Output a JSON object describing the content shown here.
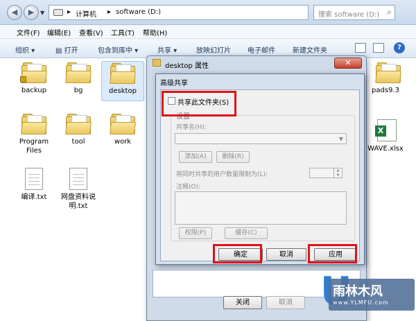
{
  "explorer": {
    "address": {
      "crumbs": [
        "计算机",
        "software (D:)"
      ]
    },
    "search_placeholder": "搜索 software (D:)",
    "menu": [
      "文件(F)",
      "编辑(E)",
      "查看(V)",
      "工具(T)",
      "帮助(H)"
    ],
    "toolbar": {
      "organize": "组织 ▾",
      "open": "打开",
      "include": "包含到库中 ▾",
      "share": "共享 ▾",
      "slideshow": "放映幻灯片",
      "email": "电子邮件",
      "new_folder": "新建文件夹"
    },
    "items": [
      {
        "label": "backup"
      },
      {
        "label": "bg"
      },
      {
        "label": "desktop"
      },
      {
        "label": "Program Files"
      },
      {
        "label": "tool"
      },
      {
        "label": "work"
      },
      {
        "label": "编译.txt"
      },
      {
        "label": "网盘资料说明.txt"
      },
      {
        "label": "pads9.3"
      },
      {
        "label": "WAVE.xlsx"
      }
    ]
  },
  "properties": {
    "title": "desktop 属性",
    "close_button": "关闭",
    "cancel_button": "取消"
  },
  "advanced_sharing": {
    "title": "高级共享",
    "share_checkbox_label": "共享此文件夹(S)",
    "share_checked": false,
    "settings_group": "设置",
    "share_name_label": "共享名(H):",
    "limit_label": "将同时共享的用户数量限制为(L):",
    "add_button": "添加(A)",
    "remove_button": "删除(R)",
    "comment_label": "注释(O):",
    "permissions_button": "权限(P)",
    "caching_button": "缓存(C)",
    "ok_button": "确定",
    "cancel_button": "取消",
    "apply_button": "应用"
  },
  "watermark": {
    "line1": "雨林木风",
    "line2": "www.YLMFU.com"
  },
  "colors": {
    "highlight": "#e01019",
    "dialog_frame": "#cfdbe9"
  }
}
